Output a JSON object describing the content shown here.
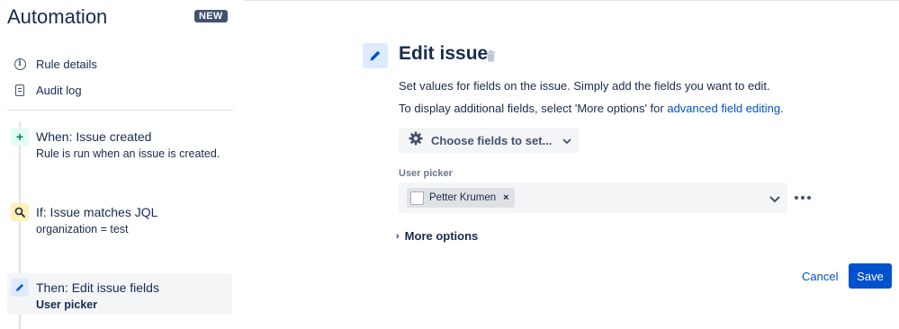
{
  "sidebar": {
    "app_title": "Automation",
    "badge": "NEW",
    "nav": [
      {
        "label": "Rule details",
        "icon": "info-icon"
      },
      {
        "label": "Audit log",
        "icon": "document-icon"
      }
    ],
    "steps": {
      "when": {
        "title": "When: Issue created",
        "subtitle": "Rule is run when an issue is created.",
        "icon": "plus-icon"
      },
      "if": {
        "title": "If: Issue matches JQL",
        "subtitle": "organization = test",
        "icon": "search-icon"
      },
      "then": {
        "title": "Then: Edit issue fields",
        "subtitle": "User picker",
        "icon": "pencil-icon"
      }
    }
  },
  "main": {
    "title": "Edit issue",
    "description": "Set values for fields on the issue. Simply add the fields you want to edit.",
    "additional_prefix": "To display additional fields, select 'More options' for ",
    "additional_link": "advanced field editing",
    "additional_suffix": ".",
    "choose_fields_label": "Choose fields to set...",
    "field_label": "User picker",
    "selected_user": "Petter Krumen",
    "remove_glyph": "×",
    "more_options_label": "More options",
    "more_options_caret": "›",
    "cancel_label": "Cancel",
    "save_label": "Save"
  },
  "colors": {
    "primary": "#0052cc",
    "text": "#172b4d",
    "muted": "#6b778c",
    "new_badge": "#42526e",
    "when_bg": "#e3fcef",
    "if_bg": "#fff0b3",
    "then_bg": "#deebff"
  }
}
